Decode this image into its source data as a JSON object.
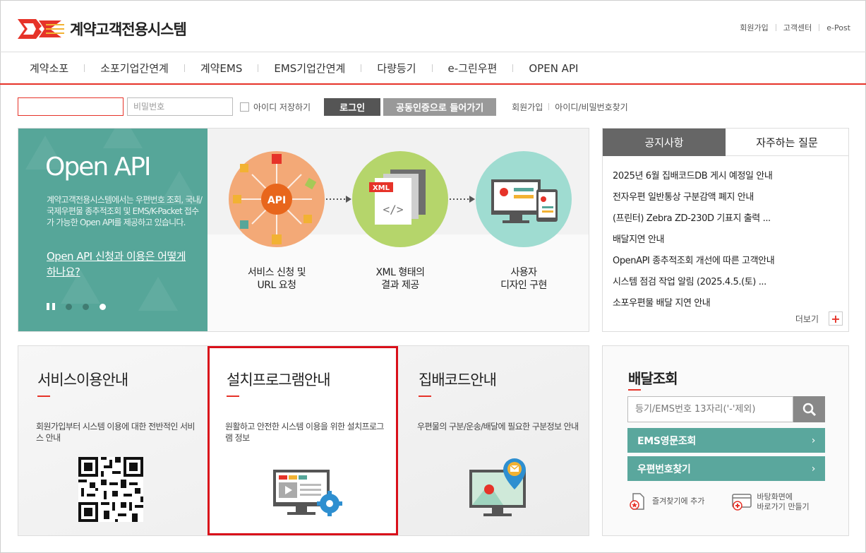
{
  "header": {
    "logo_text": "계약고객전용시스템",
    "util_links": [
      "회원가입",
      "고객센터",
      "e-Post"
    ]
  },
  "gnb": [
    "계약소포",
    "소포기업간연계",
    "계약EMS",
    "EMS기업간연계",
    "다량등기",
    "e-그린우편",
    "OPEN API"
  ],
  "login": {
    "id_value": "",
    "pw_placeholder": "비밀번호",
    "save_id_label": "아이디 저장하기",
    "login_button": "로그인",
    "cert_button": "공동인증으로 들어가기",
    "links": [
      "회원가입",
      "아이디/비밀번호찾기"
    ]
  },
  "banner": {
    "title": "Open API",
    "desc": "계약고객전용시스템에서는 우편번호 조회, 국내/국제우편물 종추적조회 및 EMS/K-Packet 접수가 가능한 Open API를 제공하고 있습니다.",
    "link": "Open API 신청과 이용은 어떻게 하나요?",
    "steps": [
      {
        "line1": "서비스 신청 및",
        "line2": "URL 요청"
      },
      {
        "line1": "XML 형태의",
        "line2": "결과 제공"
      },
      {
        "line1": "사용자",
        "line2": "디자인 구현"
      }
    ],
    "api_label": "API",
    "xml_label": "XML",
    "colors": {
      "teal": "#56a699",
      "orange": "#f3a977",
      "lime": "#b5d56b",
      "mint": "#9fdcd1"
    }
  },
  "notice": {
    "tabs": [
      "공지사항",
      "자주하는 질문"
    ],
    "items": [
      "2025년  6월 집배코드DB 게시 예정일 안내",
      "전자우편 일반통상 구분감액 폐지 안내",
      "(프린터) Zebra ZD-230D 기표지 출력 ...",
      "배달지연 안내",
      "OpenAPI 종추적조회 개선에 따른 고객안내",
      "시스템 점검 작업 알림 (2025.4.5.(토) ...",
      "소포우편물 배달 지연 안내"
    ],
    "more_label": "더보기",
    "plus": "+"
  },
  "services": [
    {
      "title": "서비스이용안내",
      "desc": "회원가입부터 시스템 이용에 대한 전반적인 서비스 안내"
    },
    {
      "title": "설치프로그램안내",
      "desc": "원활하고 안전한 시스템 이용을 위한 설치프로그램 정보"
    },
    {
      "title": "집배코드안내",
      "desc": "우편물의 구분/운송/배달에 필요한 구분정보 안내"
    }
  ],
  "delivery": {
    "title": "배달조회",
    "search_placeholder": "등기/EMS번호 13자리('-'제외)",
    "buttons": [
      "EMS영문조회",
      "우편번호찾기"
    ],
    "arrow": "›",
    "favorite": "즐겨찾기에 추가",
    "shortcut_line1": "바탕화면에",
    "shortcut_line2": "바로가기 만들기"
  },
  "colors": {
    "accent": "#e63329",
    "teal_button": "#5aa79d",
    "dark_tab": "#666666"
  }
}
